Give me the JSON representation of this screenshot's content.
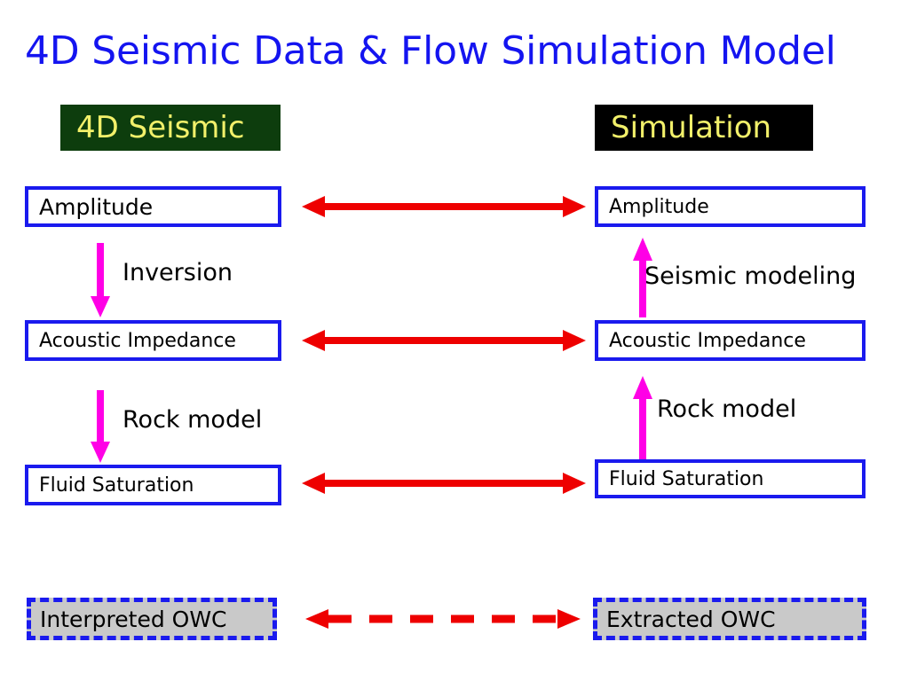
{
  "slide": {
    "title": "4D Seismic Data & Flow Simulation Model",
    "title_color": "#1414f0",
    "background": "#ffffff"
  },
  "headers": {
    "left": {
      "label": "4D Seismic",
      "background": "#0d3d0d",
      "text_color": "#f2f06a"
    },
    "right": {
      "label": "Simulation",
      "background": "#000000",
      "text_color": "#f2f06a"
    }
  },
  "columns": {
    "left": {
      "nodes": [
        {
          "label": "Amplitude"
        },
        {
          "label": "Acoustic Impedance"
        },
        {
          "label": "Fluid Saturation"
        }
      ],
      "owc": {
        "label": "Interpreted OWC"
      },
      "process_labels": [
        {
          "label": "Inversion"
        },
        {
          "label": "Rock model"
        }
      ]
    },
    "right": {
      "nodes": [
        {
          "label": "Amplitude"
        },
        {
          "label": "Acoustic Impedance"
        },
        {
          "label": "Fluid Saturation"
        }
      ],
      "owc": {
        "label": "Extracted OWC"
      },
      "process_labels": [
        {
          "label": "Seismic modeling"
        },
        {
          "label": "Rock model"
        }
      ]
    }
  },
  "connectors": {
    "horizontal_color": "#ee0000",
    "vertical_color": "#ff00e6",
    "node_border_color": "#1a1aee",
    "owc_fill": "#c9c9c9",
    "rows": [
      {
        "name": "amplitude-link",
        "style": "solid",
        "direction": "bidirectional"
      },
      {
        "name": "acoustic-impedance-link",
        "style": "solid",
        "direction": "bidirectional"
      },
      {
        "name": "fluid-saturation-link",
        "style": "solid",
        "direction": "bidirectional"
      },
      {
        "name": "owc-link",
        "style": "dashed",
        "direction": "bidirectional"
      }
    ],
    "vertical": [
      {
        "name": "inversion-arrow",
        "side": "left",
        "direction": "down"
      },
      {
        "name": "rock-model-arrow-left",
        "side": "left",
        "direction": "down"
      },
      {
        "name": "seismic-modeling-arrow",
        "side": "right",
        "direction": "up"
      },
      {
        "name": "rock-model-arrow-right",
        "side": "right",
        "direction": "up"
      }
    ]
  }
}
